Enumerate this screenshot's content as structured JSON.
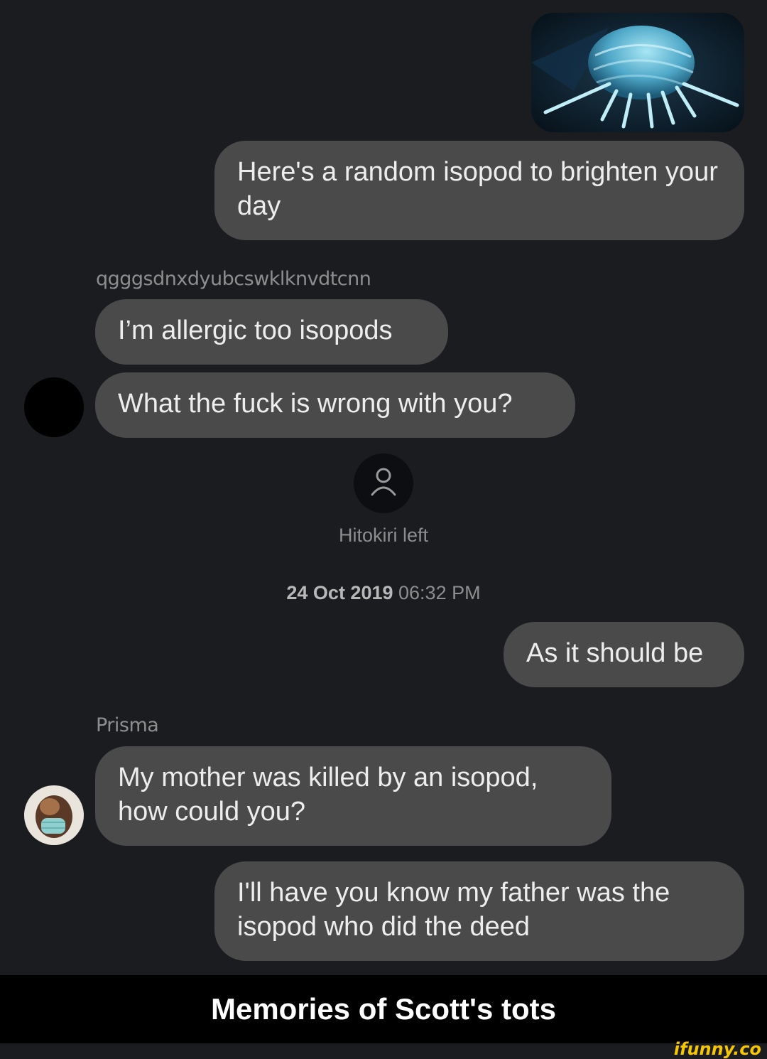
{
  "messages": {
    "msg1": "Here's a random isopod to brighten your day",
    "sender1": "qgggsdnxdyubcswklknvdtcnn",
    "msg2": "I’m allergic too isopods",
    "msg3": "What the fuck is wrong with you?",
    "left_notice": "Hitokiri left",
    "timestamp_date": "24 Oct 2019",
    "timestamp_time": "06:32 PM",
    "msg4": "As it should be",
    "sender2": "Prisma",
    "msg5": "My mother was killed by an isopod, how could you?",
    "msg6": "I'll have you know my father was the isopod who did the deed"
  },
  "caption": "Memories of Scott's tots",
  "watermark": "ifunny.co",
  "icons": {
    "isopod_image": "isopod-photo",
    "left_user": "person-icon",
    "avatar1": "avatar-black",
    "avatar2": "avatar-masked"
  },
  "colors": {
    "background": "#1a1c20",
    "bubble": "#4a4a4a",
    "text": "#ededed",
    "meta": "#8e8e8e",
    "watermark": "#f7c600"
  }
}
